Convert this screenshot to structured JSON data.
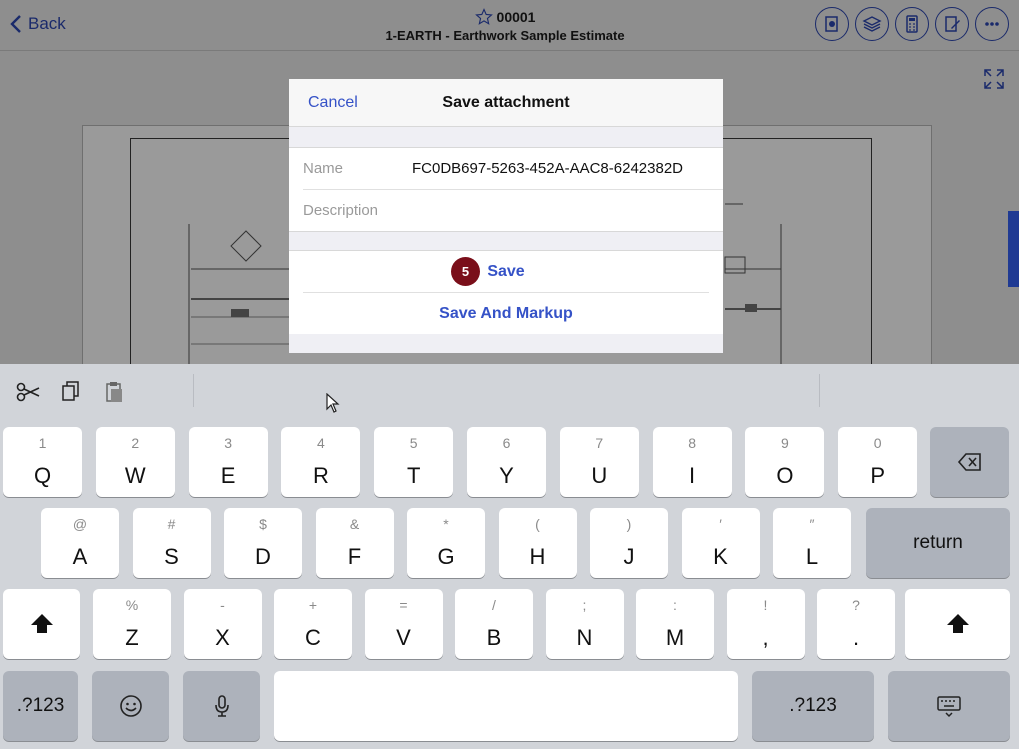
{
  "topbar": {
    "back_label": "Back",
    "title_number": "00001",
    "title_sub": "1-EARTH - Earthwork Sample Estimate",
    "icons": [
      "pin-sheet-icon",
      "layers-icon",
      "calculator-icon",
      "markup-edit-icon",
      "more-icon"
    ]
  },
  "dialog": {
    "cancel_label": "Cancel",
    "title": "Save attachment",
    "name_label": "Name",
    "name_value": "FC0DB697-5263-452A-AAC8-6242382D",
    "description_placeholder": "Description",
    "save_label": "Save",
    "save_markup_label": "Save And Markup",
    "step_badge": "5"
  },
  "keyboard": {
    "row1": [
      {
        "main": "Q",
        "sub": "1"
      },
      {
        "main": "W",
        "sub": "2"
      },
      {
        "main": "E",
        "sub": "3"
      },
      {
        "main": "R",
        "sub": "4"
      },
      {
        "main": "T",
        "sub": "5"
      },
      {
        "main": "Y",
        "sub": "6"
      },
      {
        "main": "U",
        "sub": "7"
      },
      {
        "main": "I",
        "sub": "8"
      },
      {
        "main": "O",
        "sub": "9"
      },
      {
        "main": "P",
        "sub": "0"
      }
    ],
    "row2": [
      {
        "main": "A",
        "sub": "@"
      },
      {
        "main": "S",
        "sub": "#"
      },
      {
        "main": "D",
        "sub": "$"
      },
      {
        "main": "F",
        "sub": "&"
      },
      {
        "main": "G",
        "sub": "*"
      },
      {
        "main": "H",
        "sub": "("
      },
      {
        "main": "J",
        "sub": ")"
      },
      {
        "main": "K",
        "sub": "′"
      },
      {
        "main": "L",
        "sub": "″"
      }
    ],
    "row3": [
      {
        "main": "Z",
        "sub": "%"
      },
      {
        "main": "X",
        "sub": "-"
      },
      {
        "main": "C",
        "sub": "+"
      },
      {
        "main": "V",
        "sub": "="
      },
      {
        "main": "B",
        "sub": "/"
      },
      {
        "main": "N",
        "sub": ";"
      },
      {
        "main": "M",
        "sub": ":"
      },
      {
        "main": ",",
        "sub": "!"
      },
      {
        "main": ".",
        "sub": "?"
      }
    ],
    "return_label": "return",
    "numbers_label_left": ".?123",
    "numbers_label_right": ".?123"
  }
}
